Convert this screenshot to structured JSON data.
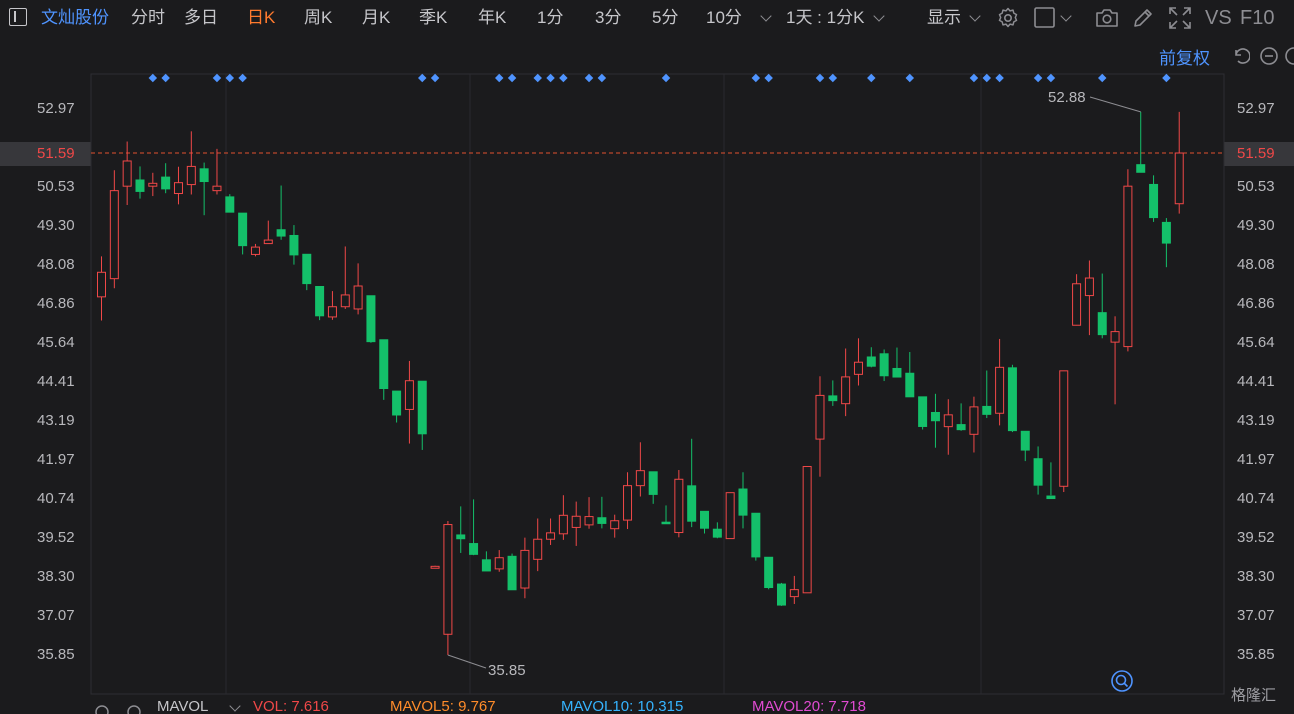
{
  "toolbar": {
    "stock_name": "文灿股份",
    "tabs": [
      "分时",
      "多日",
      "日K",
      "周K",
      "月K",
      "季K",
      "年K",
      "1分",
      "3分",
      "5分",
      "10分"
    ],
    "active_tab": "日K",
    "interval_select": "1天 : 1分K",
    "display_menu": "显示",
    "vs_label": "VS",
    "f10_label": "F10"
  },
  "subbar": {
    "adjust_label": "前复权"
  },
  "axis": {
    "ticks": [
      "52.97",
      "51.59",
      "50.53",
      "49.30",
      "48.08",
      "46.86",
      "45.64",
      "44.41",
      "43.19",
      "41.97",
      "40.74",
      "39.52",
      "38.30",
      "37.07",
      "35.85"
    ],
    "current_price": "51.59",
    "high_label": "52.88",
    "low_label": "35.85"
  },
  "legend": {
    "ind_name": "MAVOL",
    "vol": "VOL: 7.616",
    "mavol5": "MAVOL5: 9.767",
    "mavol10": "MAVOL10: 10.315",
    "mavol20": "MAVOL20: 7.718"
  },
  "brand": "格隆汇",
  "colors": {
    "up": "#f04848",
    "down": "#14c06a",
    "accent": "#ff7a2e",
    "blue": "#4f94ff",
    "mavol5": "#ff8c2a",
    "mavol10": "#35b4ff",
    "mavol20": "#e04bd2"
  },
  "chart_data": {
    "type": "candlestick",
    "ylim": [
      35.85,
      52.97
    ],
    "yticks": [
      52.97,
      51.59,
      50.53,
      49.3,
      48.08,
      46.86,
      45.64,
      44.41,
      43.19,
      41.97,
      40.74,
      39.52,
      38.3,
      37.07,
      35.85
    ],
    "current_price": 51.59,
    "high": 52.88,
    "low": 35.85,
    "dot_markers": [
      4,
      5,
      9,
      10,
      11,
      25,
      26,
      31,
      32,
      34,
      35,
      36,
      38,
      39,
      44,
      51,
      52,
      56,
      57,
      60,
      63,
      68,
      69,
      70,
      73,
      74,
      78,
      83
    ],
    "candles": [
      {
        "o": 47.08,
        "h": 48.35,
        "l": 46.34,
        "c": 47.85
      },
      {
        "o": 47.65,
        "h": 51.05,
        "l": 47.35,
        "c": 50.41
      },
      {
        "o": 50.55,
        "h": 51.95,
        "l": 49.96,
        "c": 51.34
      },
      {
        "o": 50.76,
        "h": 51.17,
        "l": 50.16,
        "c": 50.37
      },
      {
        "o": 50.55,
        "h": 50.97,
        "l": 50.24,
        "c": 50.64
      },
      {
        "o": 50.85,
        "h": 51.27,
        "l": 50.33,
        "c": 50.45
      },
      {
        "o": 50.32,
        "h": 51.16,
        "l": 49.98,
        "c": 50.66
      },
      {
        "o": 50.6,
        "h": 52.27,
        "l": 50.29,
        "c": 51.17
      },
      {
        "o": 51.11,
        "h": 51.29,
        "l": 49.64,
        "c": 50.68
      },
      {
        "o": 50.41,
        "h": 51.72,
        "l": 50.29,
        "c": 50.55
      },
      {
        "o": 50.23,
        "h": 50.3,
        "l": 49.9,
        "c": 49.72
      },
      {
        "o": 49.72,
        "h": 49.58,
        "l": 48.41,
        "c": 48.67
      },
      {
        "o": 48.41,
        "h": 48.74,
        "l": 48.35,
        "c": 48.64
      },
      {
        "o": 48.75,
        "h": 49.47,
        "l": 48.79,
        "c": 48.86
      },
      {
        "o": 49.2,
        "h": 50.57,
        "l": 48.87,
        "c": 48.97
      },
      {
        "o": 49.02,
        "h": 49.33,
        "l": 48.09,
        "c": 48.38
      },
      {
        "o": 48.43,
        "h": 48.26,
        "l": 47.29,
        "c": 47.48
      },
      {
        "o": 47.42,
        "h": 47.07,
        "l": 46.35,
        "c": 46.47
      },
      {
        "o": 46.45,
        "h": 47.26,
        "l": 46.36,
        "c": 46.77
      },
      {
        "o": 46.77,
        "h": 48.66,
        "l": 46.7,
        "c": 47.14
      },
      {
        "o": 46.7,
        "h": 48.13,
        "l": 46.53,
        "c": 47.42
      },
      {
        "o": 47.13,
        "h": 47.07,
        "l": 45.64,
        "c": 45.66
      },
      {
        "o": 45.75,
        "h": 45.52,
        "l": 43.85,
        "c": 44.19
      },
      {
        "o": 44.14,
        "h": 44.04,
        "l": 43.14,
        "c": 43.36
      },
      {
        "o": 43.55,
        "h": 45.07,
        "l": 42.48,
        "c": 44.45
      },
      {
        "o": 44.45,
        "h": 44.28,
        "l": 42.28,
        "c": 42.77
      },
      {
        "o": 38.57,
        "h": 38.65,
        "l": 38.57,
        "c": 38.63
      },
      {
        "o": 36.5,
        "h": 40.05,
        "l": 35.85,
        "c": 39.94
      },
      {
        "o": 39.63,
        "h": 40.51,
        "l": 39.05,
        "c": 39.48
      },
      {
        "o": 39.36,
        "h": 40.73,
        "l": 38.98,
        "c": 38.99
      },
      {
        "o": 38.85,
        "h": 39.1,
        "l": 38.65,
        "c": 38.47
      },
      {
        "o": 38.55,
        "h": 39.14,
        "l": 38.46,
        "c": 38.9
      },
      {
        "o": 38.96,
        "h": 39.03,
        "l": 37.91,
        "c": 37.88
      },
      {
        "o": 37.95,
        "h": 39.53,
        "l": 37.63,
        "c": 39.13
      },
      {
        "o": 38.85,
        "h": 40.13,
        "l": 38.48,
        "c": 39.48
      },
      {
        "o": 39.48,
        "h": 40.13,
        "l": 39.3,
        "c": 39.68
      },
      {
        "o": 39.65,
        "h": 40.86,
        "l": 39.46,
        "c": 40.23
      },
      {
        "o": 39.85,
        "h": 40.66,
        "l": 39.27,
        "c": 40.2
      },
      {
        "o": 39.93,
        "h": 40.8,
        "l": 39.81,
        "c": 40.19
      },
      {
        "o": 40.17,
        "h": 40.81,
        "l": 39.82,
        "c": 39.96
      },
      {
        "o": 39.81,
        "h": 40.25,
        "l": 39.53,
        "c": 40.06
      },
      {
        "o": 40.08,
        "h": 41.58,
        "l": 39.8,
        "c": 41.16
      },
      {
        "o": 41.16,
        "h": 42.52,
        "l": 40.82,
        "c": 41.63
      },
      {
        "o": 41.61,
        "h": 41.6,
        "l": 40.59,
        "c": 40.87
      },
      {
        "o": 40.03,
        "h": 40.54,
        "l": 40.02,
        "c": 39.95
      },
      {
        "o": 39.69,
        "h": 41.65,
        "l": 39.54,
        "c": 41.36
      },
      {
        "o": 41.17,
        "h": 42.63,
        "l": 39.86,
        "c": 40.03
      },
      {
        "o": 40.37,
        "h": 40.34,
        "l": 39.66,
        "c": 39.81
      },
      {
        "o": 39.81,
        "h": 40.01,
        "l": 39.51,
        "c": 39.53
      },
      {
        "o": 39.5,
        "h": 40.63,
        "l": 39.49,
        "c": 40.94
      },
      {
        "o": 41.07,
        "h": 41.58,
        "l": 39.82,
        "c": 40.22
      },
      {
        "o": 40.31,
        "h": 39.95,
        "l": 38.81,
        "c": 38.91
      },
      {
        "o": 38.93,
        "h": 38.67,
        "l": 37.91,
        "c": 37.95
      },
      {
        "o": 38.09,
        "h": 38.11,
        "l": 37.39,
        "c": 37.4
      },
      {
        "o": 37.68,
        "h": 38.33,
        "l": 37.45,
        "c": 37.9
      },
      {
        "o": 37.8,
        "h": 41.76,
        "l": 37.8,
        "c": 41.76
      },
      {
        "o": 42.62,
        "h": 44.59,
        "l": 41.44,
        "c": 43.99
      },
      {
        "o": 43.99,
        "h": 44.46,
        "l": 43.66,
        "c": 43.81
      },
      {
        "o": 43.73,
        "h": 45.46,
        "l": 43.34,
        "c": 44.57
      },
      {
        "o": 44.65,
        "h": 45.78,
        "l": 44.3,
        "c": 45.03
      },
      {
        "o": 45.21,
        "h": 45.5,
        "l": 44.87,
        "c": 44.89
      },
      {
        "o": 45.31,
        "h": 45.43,
        "l": 44.44,
        "c": 44.59
      },
      {
        "o": 44.85,
        "h": 45.49,
        "l": 44.58,
        "c": 44.55
      },
      {
        "o": 44.7,
        "h": 45.35,
        "l": 44.2,
        "c": 43.93
      },
      {
        "o": 43.96,
        "h": 43.47,
        "l": 42.92,
        "c": 43.0
      },
      {
        "o": 43.47,
        "h": 44.04,
        "l": 42.35,
        "c": 43.18
      },
      {
        "o": 43.01,
        "h": 43.87,
        "l": 42.13,
        "c": 43.38
      },
      {
        "o": 43.09,
        "h": 43.74,
        "l": 42.88,
        "c": 42.9
      },
      {
        "o": 42.77,
        "h": 43.95,
        "l": 42.2,
        "c": 43.63
      },
      {
        "o": 43.66,
        "h": 44.77,
        "l": 43.28,
        "c": 43.38
      },
      {
        "o": 43.43,
        "h": 45.76,
        "l": 43.05,
        "c": 44.87
      },
      {
        "o": 44.87,
        "h": 44.95,
        "l": 42.84,
        "c": 42.87
      },
      {
        "o": 42.88,
        "h": 42.86,
        "l": 41.93,
        "c": 42.26
      },
      {
        "o": 42.02,
        "h": 42.39,
        "l": 40.88,
        "c": 41.16
      },
      {
        "o": 40.85,
        "h": 41.89,
        "l": 40.86,
        "c": 40.74
      },
      {
        "o": 41.14,
        "h": 44.49,
        "l": 40.96,
        "c": 44.76
      },
      {
        "o": 46.19,
        "h": 47.79,
        "l": 46.18,
        "c": 47.49
      },
      {
        "o": 47.12,
        "h": 48.22,
        "l": 45.88,
        "c": 47.67
      },
      {
        "o": 46.6,
        "h": 47.81,
        "l": 45.78,
        "c": 45.88
      },
      {
        "o": 45.66,
        "h": 46.47,
        "l": 43.71,
        "c": 45.99
      },
      {
        "o": 45.52,
        "h": 51.08,
        "l": 45.37,
        "c": 50.55
      },
      {
        "o": 51.24,
        "h": 52.88,
        "l": 51.07,
        "c": 50.97
      },
      {
        "o": 50.62,
        "h": 50.89,
        "l": 49.43,
        "c": 49.55
      },
      {
        "o": 49.43,
        "h": 49.55,
        "l": 48.01,
        "c": 48.75
      },
      {
        "o": 50.0,
        "h": 52.88,
        "l": 49.69,
        "c": 51.59
      }
    ]
  }
}
